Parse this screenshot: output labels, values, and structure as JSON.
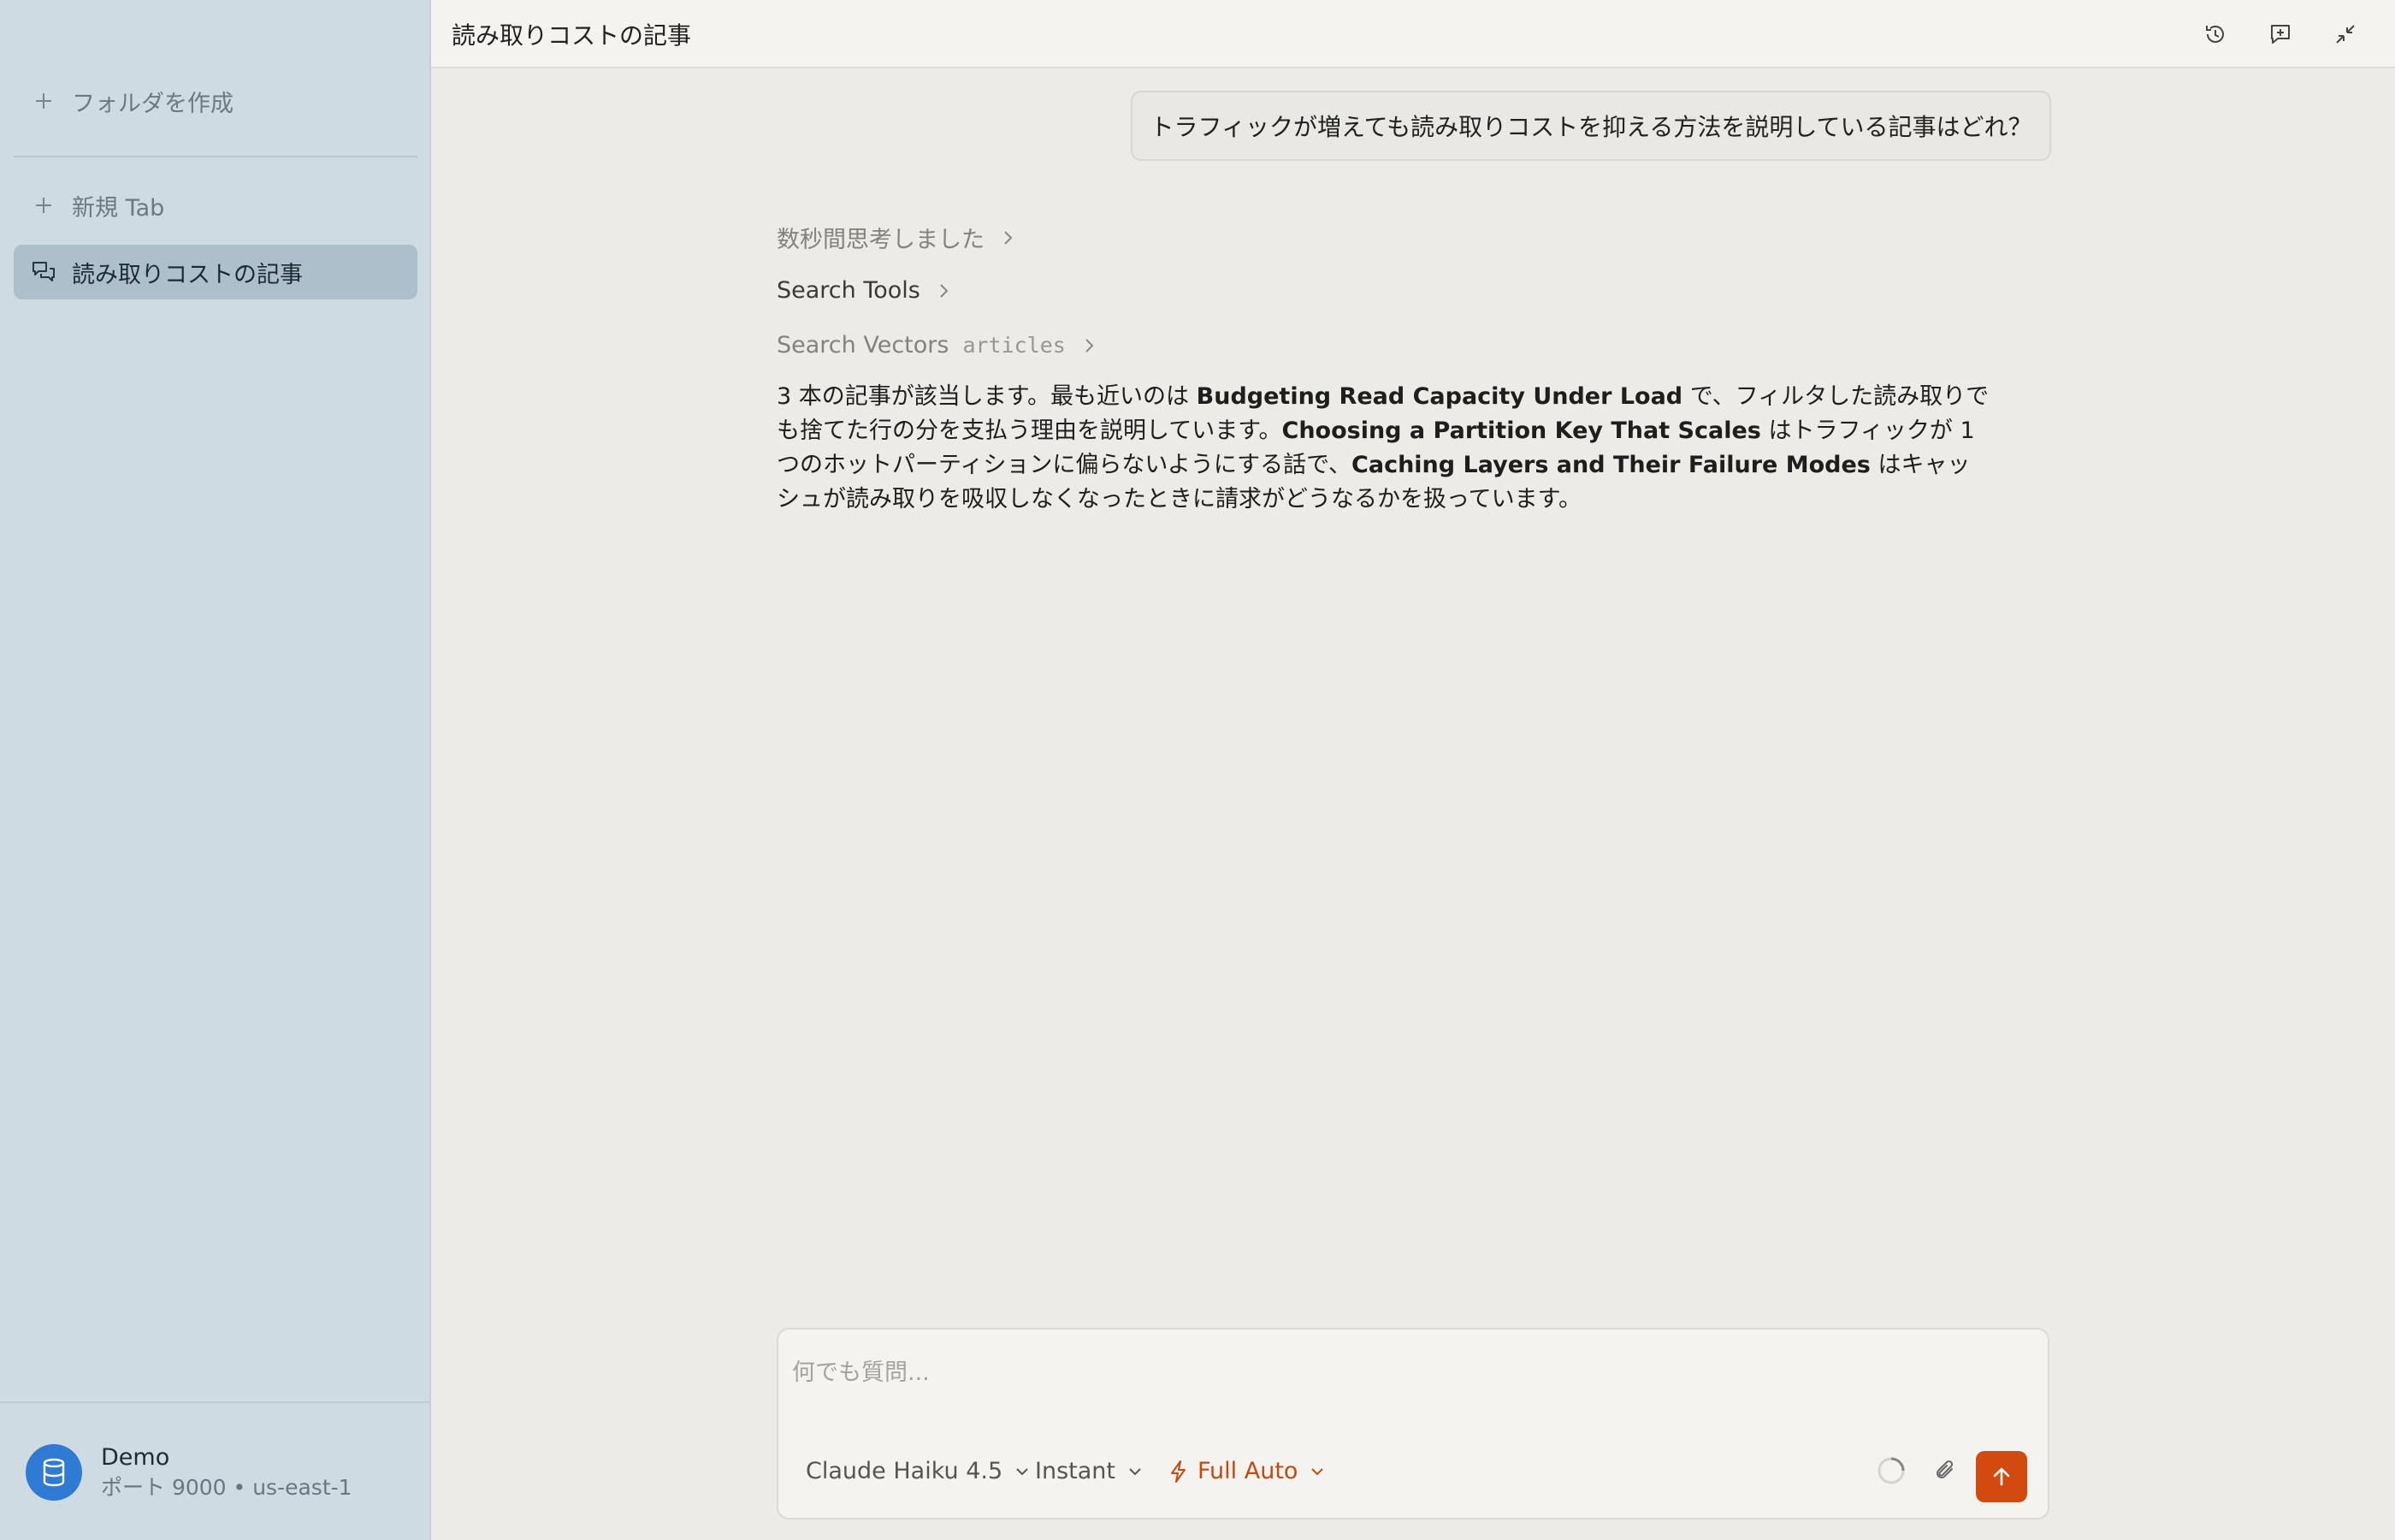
{
  "sidebar": {
    "create_folder": "フォルダを作成",
    "new_tab": "新規 Tab",
    "active_chat": "読み取りコストの記事",
    "profile": {
      "name": "Demo",
      "detail": "ポート 9000 • us-east-1"
    }
  },
  "header": {
    "title": "読み取りコストの記事"
  },
  "conversation": {
    "user_message": "トラフィックが増えても読み取りコストを抑える方法を説明している記事はどれ？",
    "steps": {
      "thought": "数秒間思考しました",
      "tools": "Search Tools",
      "vectors": "Search Vectors",
      "vectors_arg": "articles"
    },
    "answer": {
      "p1": "3 本の記事が該当します。最も近いのは ",
      "b1": "Budgeting Read Capacity Under Load",
      "p2": " で、フィルタした読み取りでも捨てた行の分を支払う理由を説明しています。",
      "b2": "Choosing a Partition Key That Scales",
      "p3": " はトラフィックが 1 つのホットパーティションに偏らないようにする話で、",
      "b3": "Caching Layers and Their Failure Modes",
      "p4": " はキャッシュが読み取りを吸収しなくなったときに請求がどうなるかを扱っています。"
    }
  },
  "composer": {
    "placeholder": "何でも質問...",
    "model": "Claude Haiku 4.5",
    "mode": "Instant",
    "auto": "Full Auto"
  },
  "colors": {
    "accent": "#d24a10",
    "sidebar_bg": "#cfdbe3",
    "avatar": "#2f7ad3"
  }
}
